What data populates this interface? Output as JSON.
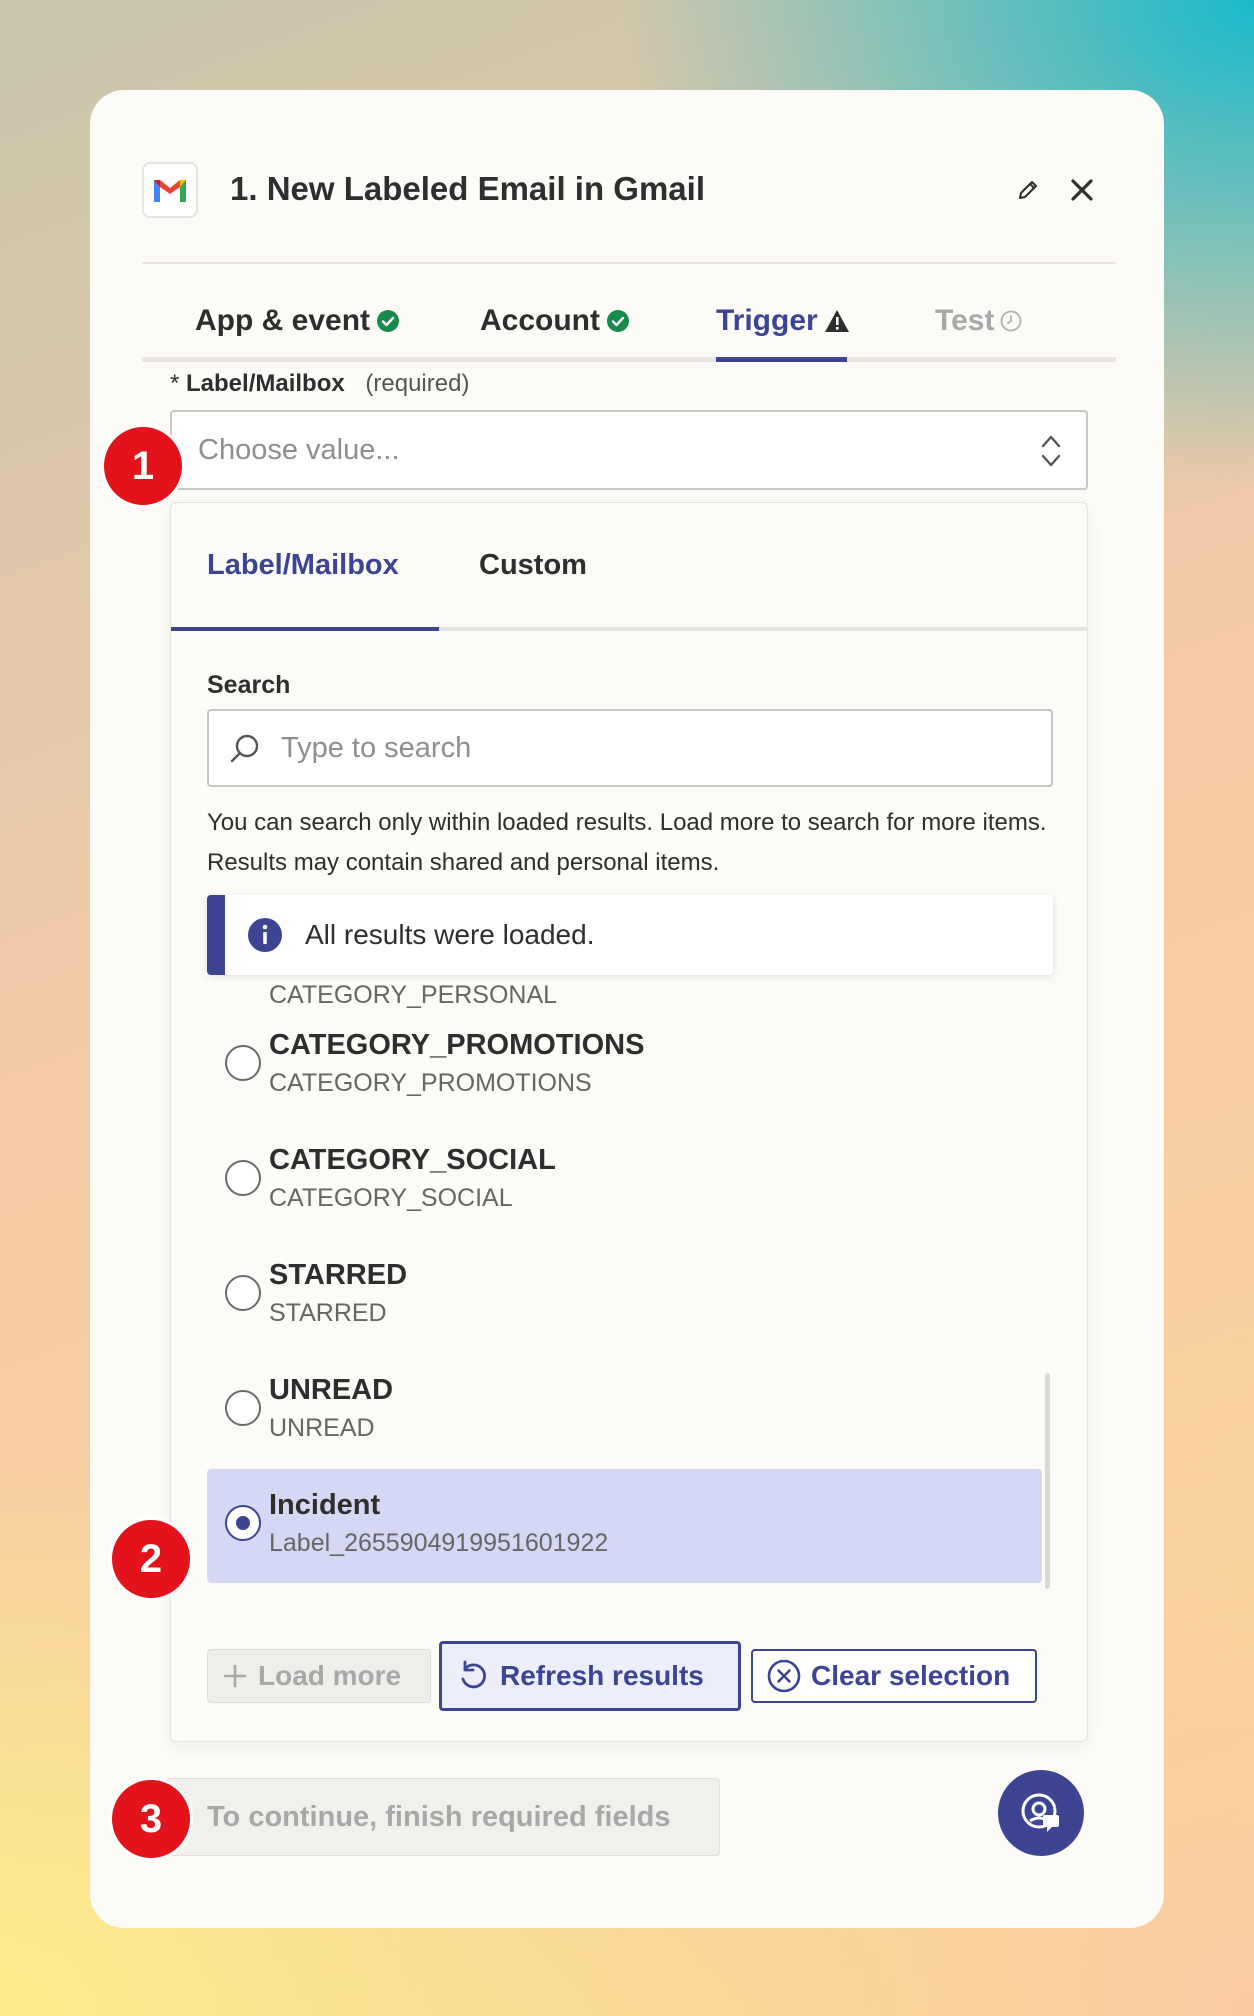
{
  "header": {
    "title": "1. New Labeled Email in Gmail",
    "app_icon": "gmail-logo",
    "edit_icon": "pencil-icon",
    "close_icon": "close-icon"
  },
  "steps": [
    {
      "label": "App & event",
      "status": "complete"
    },
    {
      "label": "Account",
      "status": "complete"
    },
    {
      "label": "Trigger",
      "status": "warning"
    },
    {
      "label": "Test",
      "status": "pending"
    }
  ],
  "field": {
    "label": "Label/Mailbox",
    "required_text": "(required)",
    "required_marker": "*",
    "placeholder": "Choose value..."
  },
  "dropdown": {
    "tabs": [
      "Label/Mailbox",
      "Custom"
    ],
    "search_label": "Search",
    "search_placeholder": "Type to search",
    "hint": "You can search only within loaded results. Load more to search for more items. Results may contain shared and personal items.",
    "info": "All results were loaded.",
    "partial_item": "CATEGORY_PERSONAL",
    "items": [
      {
        "name": "CATEGORY_PROMOTIONS",
        "id": "CATEGORY_PROMOTIONS",
        "selected": false
      },
      {
        "name": "CATEGORY_SOCIAL",
        "id": "CATEGORY_SOCIAL",
        "selected": false
      },
      {
        "name": "STARRED",
        "id": "STARRED",
        "selected": false
      },
      {
        "name": "UNREAD",
        "id": "UNREAD",
        "selected": false
      },
      {
        "name": "Incident",
        "id": "Label_2655904919951601922",
        "selected": true
      }
    ],
    "buttons": {
      "load_more": "Load more",
      "refresh": "Refresh results",
      "clear": "Clear selection"
    }
  },
  "footer": {
    "continue_label": "To continue, finish required fields",
    "help_icon": "support-chat-icon"
  },
  "badges": [
    "1",
    "2",
    "3"
  ],
  "colors": {
    "accent": "#3d4592",
    "success": "#1a8a4c",
    "badge": "#e3121b",
    "selected_bg": "#d4d8f5"
  }
}
